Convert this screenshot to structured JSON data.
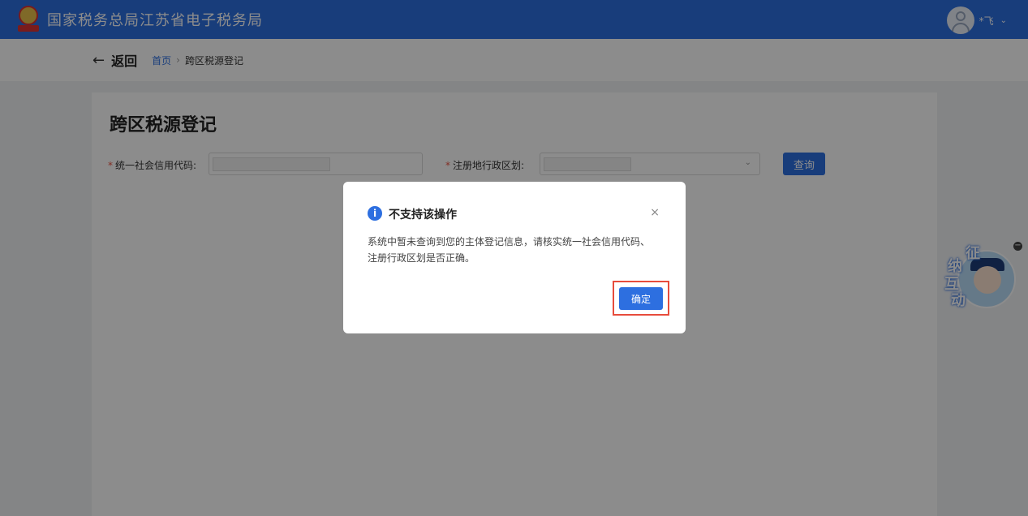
{
  "header": {
    "site_title": "国家税务总局江苏省电子税务局",
    "user_name": "*飞",
    "user_chevron": "⌄"
  },
  "subbar": {
    "back_arrow": "←",
    "back_label": "返回",
    "breadcrumb": {
      "home": "首页",
      "separator": "›",
      "current": "跨区税源登记"
    }
  },
  "form": {
    "page_title": "跨区税源登记",
    "required_mark": "*",
    "credit_code_label": "统一社会信用代码:",
    "region_label": "注册地行政区划:",
    "select_chevron": "⌄",
    "query_label": "查询"
  },
  "modal": {
    "icon_glyph": "i",
    "title": "不支持该操作",
    "close_glyph": "×",
    "message_line1": "系统中暂未查询到您的主体登记信息，请核实统一社会信用代码、",
    "message_line2": "注册行政区划是否正确。",
    "confirm_label": "确定"
  },
  "assistant": {
    "chars": [
      "征",
      "纳",
      "互",
      "动"
    ],
    "minimize_glyph": "−"
  },
  "colors": {
    "primary": "#2d6fe0",
    "highlight_border": "#e74c3c",
    "required": "#ee5544"
  }
}
